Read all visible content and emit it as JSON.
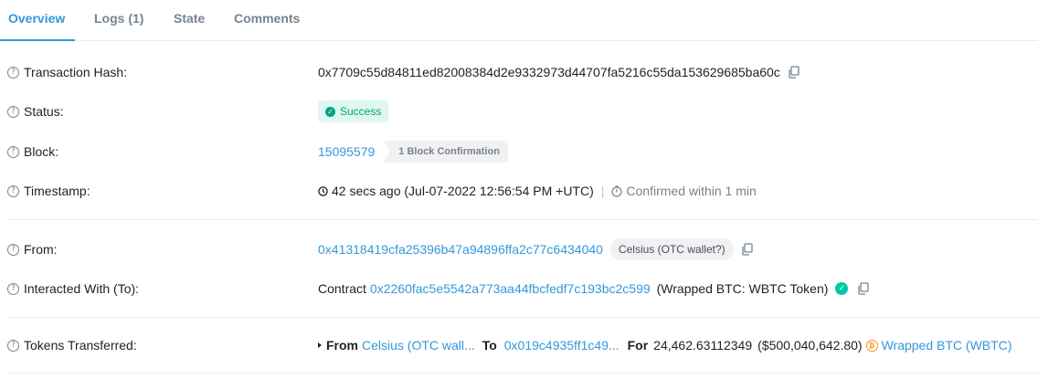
{
  "tabs": [
    {
      "label": "Overview",
      "active": true
    },
    {
      "label": "Logs (1)",
      "active": false
    },
    {
      "label": "State",
      "active": false
    },
    {
      "label": "Comments",
      "active": false
    }
  ],
  "help_glyph": "?",
  "tx_hash": {
    "label": "Transaction Hash:",
    "value": "0x7709c55d84811ed82008384d2e9332973d44707fa5216c55da153629685ba60c"
  },
  "status": {
    "label": "Status:",
    "value": "Success",
    "color": "#00a186"
  },
  "block": {
    "label": "Block:",
    "number": "15095579",
    "confirmations": "1 Block Confirmation"
  },
  "timestamp": {
    "label": "Timestamp:",
    "value": "42 secs ago (Jul-07-2022 12:56:54 PM +UTC)",
    "separator": "|",
    "confirmed": "Confirmed within 1 min"
  },
  "from": {
    "label": "From:",
    "address": "0x41318419cfa25396b47a94896ffa2c77c6434040",
    "tag": "Celsius (OTC wallet?)"
  },
  "interacted": {
    "label": "Interacted With (To):",
    "prefix": "Contract",
    "address": "0x2260fac5e5542a773aa44fbcfedf7c193bc2c599",
    "name": "(Wrapped BTC: WBTC Token)"
  },
  "tokens": {
    "label": "Tokens Transferred:",
    "from_label": "From",
    "from_value": "Celsius (OTC wall...",
    "to_label": "To",
    "to_value": "0x019c4935ff1c49...",
    "for_label": "For",
    "amount": "24,462.63112349",
    "usd": "($500,040,642.80)",
    "token_icon": "btc-icon",
    "token": "Wrapped BTC (WBTC)"
  },
  "colors": {
    "link": "#3498db",
    "text": "#1e2022",
    "muted": "#77838f",
    "success_bg": "#dff7ef"
  }
}
